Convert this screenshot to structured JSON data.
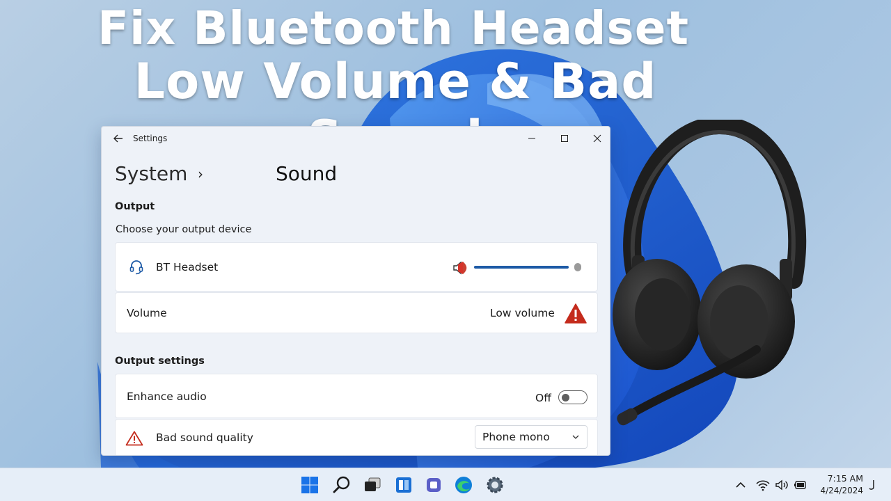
{
  "headline": {
    "line1": "Fix Bluetooth Headset",
    "line2": "Low Volume & Bad Sound"
  },
  "window": {
    "title": "Settings",
    "breadcrumb": {
      "parent": "System",
      "separator": "›",
      "current": "Sound"
    },
    "output": {
      "section_label": "Output",
      "choose_label": "Choose your output device",
      "device_name": "BT Headset",
      "device_icon": "headset-icon",
      "volume_label": "Volume",
      "volume_status": "Low volume",
      "volume_level": 0.82
    },
    "output_settings": {
      "section_label": "Output settings",
      "enhance_label": "Enhance audio",
      "enhance_state": "Off",
      "quality_label": "Bad sound quality",
      "format_value": "Phone mono"
    }
  },
  "taskbar": {
    "time": "7:15 AM",
    "date": "4/24/2024"
  },
  "colors": {
    "accent": "#1d5aa6",
    "warning": "#c42b1c",
    "taskbar_bg": "#e6eef8"
  }
}
